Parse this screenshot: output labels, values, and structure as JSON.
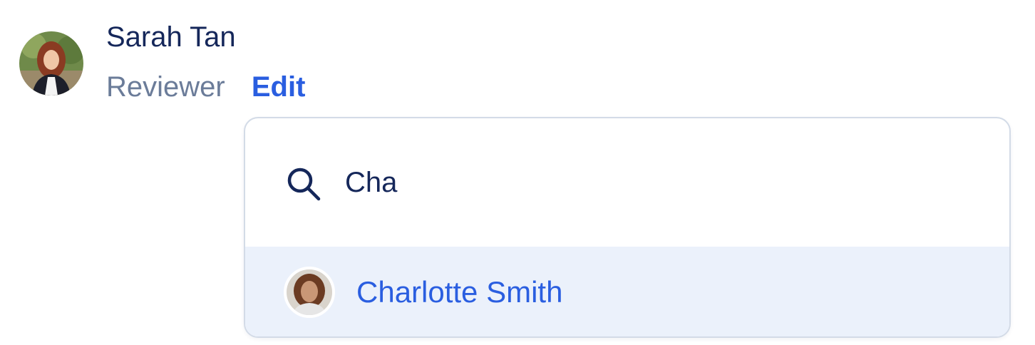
{
  "user": {
    "name": "Sarah Tan",
    "role": "Reviewer",
    "edit_label": "Edit"
  },
  "search": {
    "value": "Cha",
    "placeholder": ""
  },
  "results": [
    {
      "name": "Charlotte Smith"
    }
  ],
  "colors": {
    "name_text": "#15275a",
    "muted_text": "#6b7c99",
    "accent": "#2a5ee0",
    "highlight_bg": "#ebf1fb",
    "border": "#d3dbe7"
  },
  "icons": {
    "search": "search-icon"
  }
}
